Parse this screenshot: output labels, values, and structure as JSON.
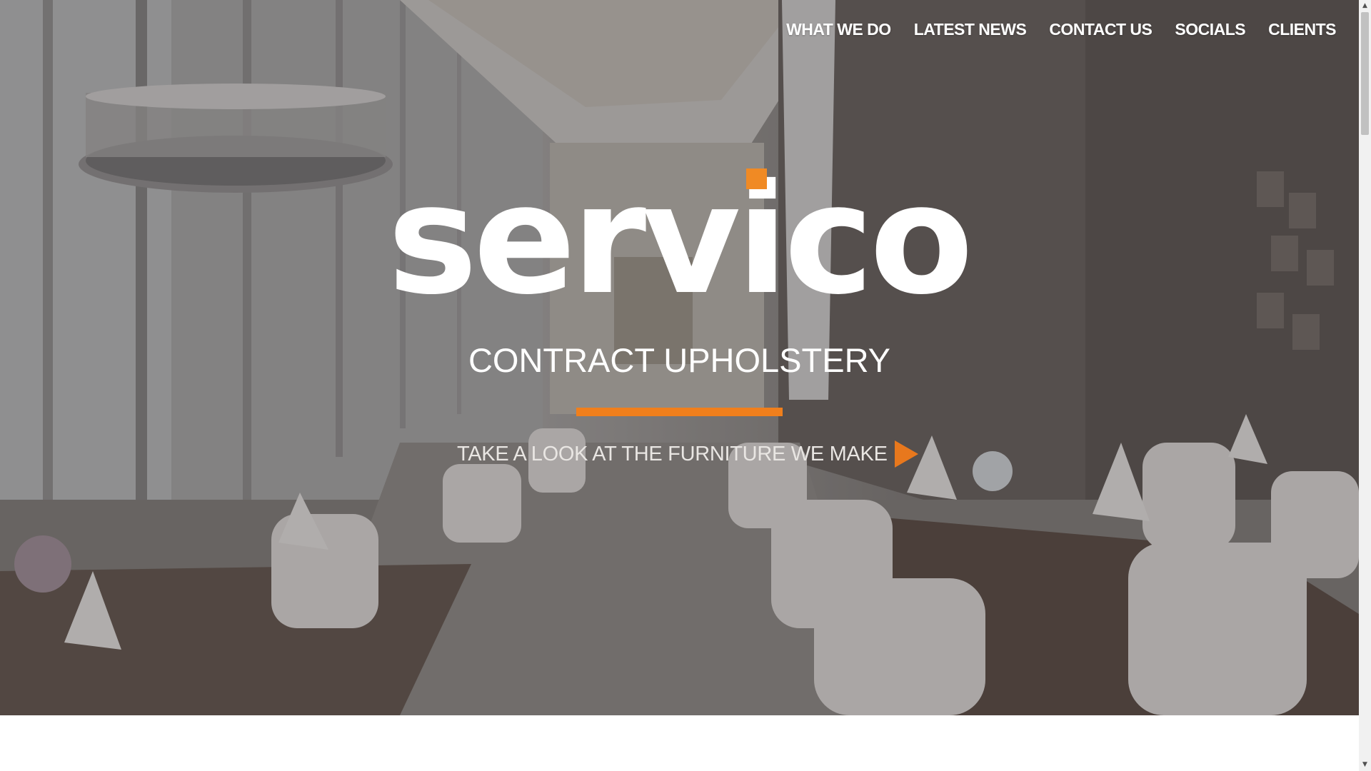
{
  "nav": {
    "items": [
      {
        "label": "WHAT WE DO"
      },
      {
        "label": "LATEST NEWS"
      },
      {
        "label": "CONTACT US"
      },
      {
        "label": "SOCIALS"
      },
      {
        "label": "CLIENTS"
      }
    ]
  },
  "hero": {
    "logo_text": "servico",
    "tagline": "CONTRACT UPHOLSTERY",
    "cta_label": "TAKE A LOOK AT THE FURNITURE WE MAKE",
    "background": "restaurant-interior-photo"
  },
  "colors": {
    "accent": "#f07f1c",
    "text": "#ffffff",
    "page_background": "#ffffff"
  },
  "icons": {
    "cta": "play-arrow-icon",
    "scroll_up": "scroll-up-arrow-icon",
    "scroll_down": "scroll-down-arrow-icon"
  }
}
